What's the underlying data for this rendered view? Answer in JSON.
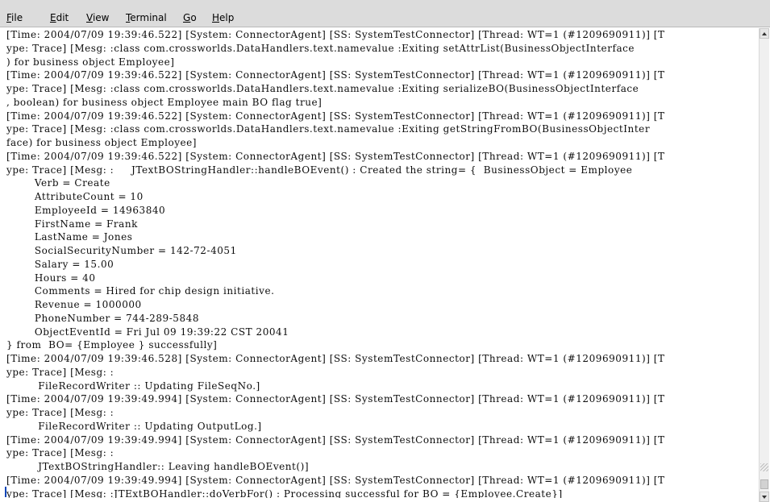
{
  "menu": {
    "file": {
      "mnemonic": "F",
      "rest": "ile"
    },
    "edit": {
      "mnemonic": "E",
      "rest": "dit"
    },
    "view": {
      "mnemonic": "V",
      "rest": "iew"
    },
    "terminal": {
      "mnemonic": "T",
      "rest": "erminal"
    },
    "go": {
      "mnemonic": "G",
      "rest": "o"
    },
    "help": {
      "mnemonic": "H",
      "rest": "elp"
    }
  },
  "terminal": {
    "text": "[Time: 2004/07/09 19:39:46.522] [System: ConnectorAgent] [SS: SystemTestConnector] [Thread: WT=1 (#1209690911)] [T\nype: Trace] [Mesg: :class com.crossworlds.DataHandlers.text.namevalue :Exiting setAttrList(BusinessObjectInterface\n) for business object Employee]\n[Time: 2004/07/09 19:39:46.522] [System: ConnectorAgent] [SS: SystemTestConnector] [Thread: WT=1 (#1209690911)] [T\nype: Trace] [Mesg: :class com.crossworlds.DataHandlers.text.namevalue :Exiting serializeBO(BusinessObjectInterface\n, boolean) for business object Employee main BO flag true]\n[Time: 2004/07/09 19:39:46.522] [System: ConnectorAgent] [SS: SystemTestConnector] [Thread: WT=1 (#1209690911)] [T\nype: Trace] [Mesg: :class com.crossworlds.DataHandlers.text.namevalue :Exiting getStringFromBO(BusinessObjectInter\nface) for business object Employee]\n[Time: 2004/07/09 19:39:46.522] [System: ConnectorAgent] [SS: SystemTestConnector] [Thread: WT=1 (#1209690911)] [T\nype: Trace] [Mesg: :     JTextBOStringHandler::handleBOEvent() : Created the string= {  BusinessObject = Employee\n        Verb = Create\n        AttributeCount = 10\n        EmployeeId = 14963840\n        FirstName = Frank\n        LastName = Jones\n        SocialSecurityNumber = 142-72-4051\n        Salary = 15.00\n        Hours = 40\n        Comments = Hired for chip design initiative.\n        Revenue = 1000000\n        PhoneNumber = 744-289-5848\n        ObjectEventId = Fri Jul 09 19:39:22 CST 20041\n} from  BO= {Employee } successfully]\n[Time: 2004/07/09 19:39:46.528] [System: ConnectorAgent] [SS: SystemTestConnector] [Thread: WT=1 (#1209690911)] [T\nype: Trace] [Mesg: :\n         FileRecordWriter :: Updating FileSeqNo.]\n[Time: 2004/07/09 19:39:49.994] [System: ConnectorAgent] [SS: SystemTestConnector] [Thread: WT=1 (#1209690911)] [T\nype: Trace] [Mesg: :\n         FileRecordWriter :: Updating OutputLog.]\n[Time: 2004/07/09 19:39:49.994] [System: ConnectorAgent] [SS: SystemTestConnector] [Thread: WT=1 (#1209690911)] [T\nype: Trace] [Mesg: :\n         JTextBOStringHandler:: Leaving handleBOEvent()]\n[Time: 2004/07/09 19:39:49.994] [System: ConnectorAgent] [SS: SystemTestConnector] [Thread: WT=1 (#1209690911)] [T\nype: Trace] [Mesg: :JTExtBOHandler::doVerbFor() : Processing successful for BO = {Employee.Create}]"
  },
  "icons": {
    "scroll_up": "arrow-up",
    "scroll_down": "arrow-down",
    "resize": "resize-grip"
  },
  "colors": {
    "menubar_background": "#dcdcdc",
    "terminal_background": "#ffffff",
    "terminal_foreground": "#0d0d0d",
    "caret": "#0a46b8"
  }
}
